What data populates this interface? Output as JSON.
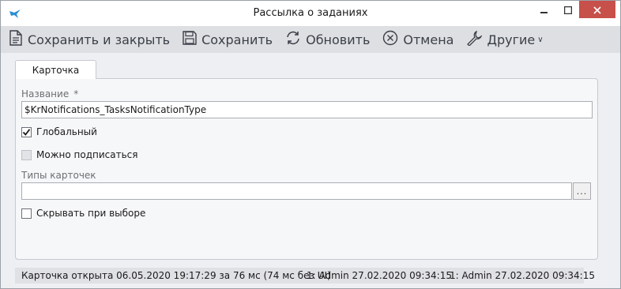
{
  "window": {
    "title": "Рассылка о заданиях"
  },
  "toolbar": {
    "save_close": "Сохранить и закрыть",
    "save": "Сохранить",
    "refresh": "Обновить",
    "cancel": "Отмена",
    "other": "Другие",
    "other_chevron": "∨"
  },
  "tabs": [
    {
      "label": "Карточка"
    }
  ],
  "form": {
    "name_label": "Название",
    "name_required": "*",
    "name_value": "$KrNotifications_TasksNotificationType",
    "global_label": "Глобальный",
    "global_checked": true,
    "subscribe_label": "Можно подписаться",
    "subscribe_checked": false,
    "card_types_label": "Типы карточек",
    "card_types_value": "",
    "ellipsis": "...",
    "hide_label": "Скрывать при выборе",
    "hide_checked": false
  },
  "status": {
    "opened": "Карточка открыта 06.05.2020 19:17:29 за 76 мс (74 мс без UI)",
    "created": "1:  Admin  27.02.2020 09:34:15",
    "modified": "1:  Admin  27.02.2020 09:34:15"
  },
  "colors": {
    "close_button": "#c7504a",
    "toolbar_bg": "#dedfe3",
    "window_bg": "#eeeff2"
  }
}
